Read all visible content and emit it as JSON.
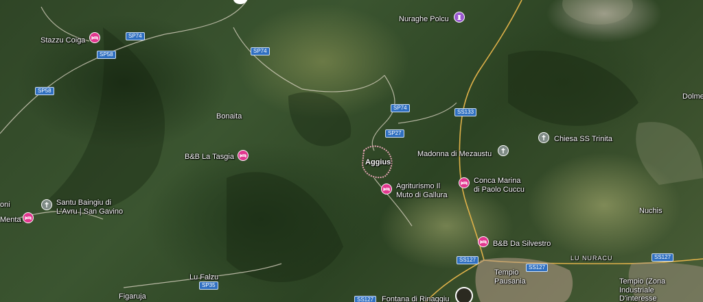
{
  "map": {
    "type": "satellite",
    "places": [
      {
        "id": "stazzu-coiga",
        "label": "Stazzu Coiga",
        "icon": "lodging-icon"
      },
      {
        "id": "nuraghe-polcu",
        "label": "Nuraghe Polcu",
        "icon": "monument-icon"
      },
      {
        "id": "bonaita",
        "label": "Bonaita",
        "icon": null
      },
      {
        "id": "bb-la-tasgia",
        "label": "B&B La Tasgia",
        "icon": "lodging-icon"
      },
      {
        "id": "aggius",
        "label": "Aggius",
        "icon": null
      },
      {
        "id": "madonna-di-mezaustu",
        "label": "Madonna di Mezaustu",
        "icon": "church-icon"
      },
      {
        "id": "chiesa-ss-trinita",
        "label": "Chiesa SS Trinita",
        "icon": "church-icon"
      },
      {
        "id": "agriturismo-line1",
        "label": "Agriturismo Il",
        "icon": "lodging-icon"
      },
      {
        "id": "agriturismo-line2",
        "label": "Muto di Gallura",
        "icon": null
      },
      {
        "id": "conca-line1",
        "label": "Conca Marina",
        "icon": "lodging-icon"
      },
      {
        "id": "conca-line2",
        "label": "di Paolo Cuccu",
        "icon": null
      },
      {
        "id": "santu-line1",
        "label": "Santu Baingiu di",
        "icon": "church-icon"
      },
      {
        "id": "santu-line2",
        "label": "L'Avru | San Gavino",
        "icon": null
      },
      {
        "id": "oni",
        "label": "oni",
        "icon": null
      },
      {
        "id": "menta",
        "label": "Menta",
        "icon": "lodging-icon"
      },
      {
        "id": "nuchis",
        "label": "Nuchis",
        "icon": null
      },
      {
        "id": "dolme",
        "label": "Dolme",
        "icon": null
      },
      {
        "id": "bb-da-silvestro",
        "label": "B&B Da Silvestro",
        "icon": "lodging-icon"
      },
      {
        "id": "lu-nuracu",
        "label": "LU NURACU",
        "icon": null
      },
      {
        "id": "tempio-line1",
        "label": "Tempio",
        "icon": null
      },
      {
        "id": "tempio-line2",
        "label": "Pausania",
        "icon": null
      },
      {
        "id": "tempio-zona-line1",
        "label": "Tempio (Zona",
        "icon": null
      },
      {
        "id": "tempio-zona-line2",
        "label": "Industriale",
        "icon": null
      },
      {
        "id": "tempio-zona-line3",
        "label": "D'interesse",
        "icon": null
      },
      {
        "id": "lu-falzu",
        "label": "Lu Falzu",
        "icon": null
      },
      {
        "id": "figaruja",
        "label": "Figaruja",
        "icon": null
      },
      {
        "id": "fontana",
        "label": "Fontana di Rinaggiu",
        "icon": null
      }
    ],
    "road_labels": [
      "SP74",
      "SP58",
      "SP74",
      "SP58",
      "SP74",
      "SP27",
      "SS133",
      "SS127",
      "SS127",
      "SS127",
      "SP35",
      "SS127"
    ],
    "colors": {
      "lodging_pin": "#e2378f",
      "church_pin": "#7f8b86",
      "monument_pin": "#9b59d0",
      "road_badge": "#2f6fc0",
      "main_road": "#e0b24a"
    }
  }
}
